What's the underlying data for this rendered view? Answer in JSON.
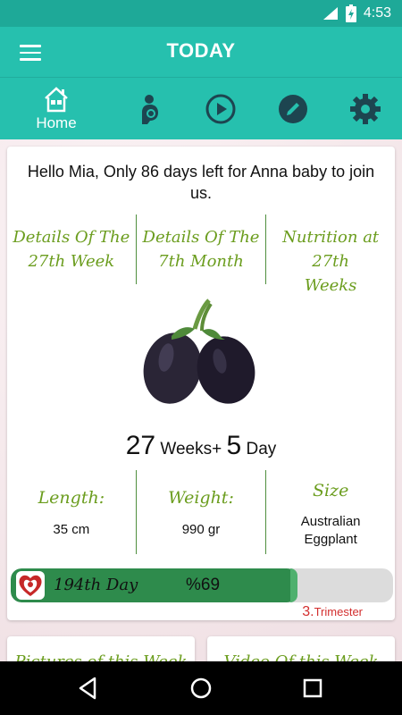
{
  "status_bar": {
    "time": "4:53"
  },
  "app_bar": {
    "title": "TODAY"
  },
  "tabs": [
    {
      "name": "home",
      "label": "Home",
      "icon": "home-icon"
    },
    {
      "name": "baby",
      "icon": "baby-icon"
    },
    {
      "name": "video",
      "icon": "play-icon"
    },
    {
      "name": "notes",
      "icon": "pencil-icon"
    },
    {
      "name": "settings",
      "icon": "gear-icon"
    }
  ],
  "card": {
    "greeting": "Hello Mia, Only 86 days left for Anna baby to join us.",
    "details": [
      {
        "line1": "Details Of The",
        "line2": "27th Week"
      },
      {
        "line1": "Details Of The",
        "line2": "7th Month"
      },
      {
        "line1": "Nutrition at 27th",
        "line2": "Weeks"
      }
    ],
    "fruit_icon": "eggplant-image",
    "weeks": {
      "week_num": "27",
      "weeks_text": " Weeks+ ",
      "day_num": "5",
      "day_text": " Day"
    },
    "stats": {
      "length_label": "Length:",
      "length_value": "35 cm",
      "weight_label": "Weight:",
      "weight_value": "990 gr",
      "size_label": "Size",
      "size_value_line1": "Australian",
      "size_value_line2": "Eggplant"
    },
    "progress": {
      "day_label": "194th Day",
      "percent_label": "%69",
      "fraction": 0.69
    },
    "trimester": {
      "number": "3.",
      "label": "Trimester"
    }
  },
  "bottom_cards": [
    {
      "title": "Pictures of this Week"
    },
    {
      "title": "Video Of this Week"
    }
  ],
  "colors": {
    "primary": "#26c0ae",
    "primary_dark": "#1ea998",
    "accent_green": "#6b9d1e",
    "progress_fill": "#2e8b4c",
    "trimester_red": "#d32f2f"
  }
}
